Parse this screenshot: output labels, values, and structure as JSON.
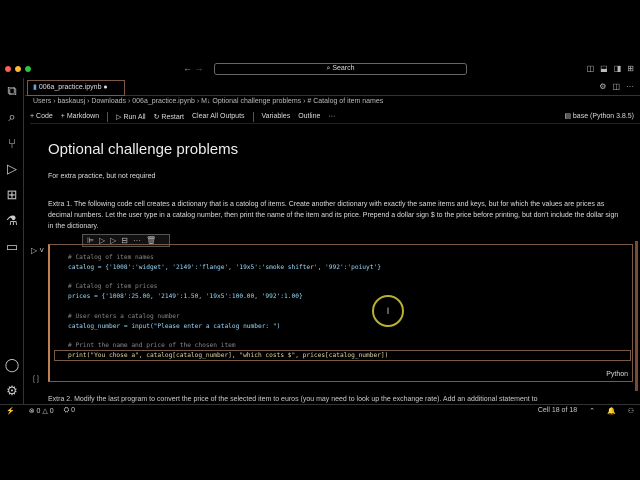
{
  "window": {
    "search": "Search",
    "nav_back": "←",
    "nav_forward": "→"
  },
  "tab": {
    "label": "006a_practice.ipynb",
    "dirty": "●"
  },
  "breadcrumb": [
    "Users",
    "baskausj",
    "Downloads",
    "006a_practice.ipynb",
    "M↓ Optional challenge problems",
    "# Catalog of item names"
  ],
  "toolbar": {
    "code": "+ Code",
    "markdown": "+ Markdown",
    "run_all": "▷ Run All",
    "restart": "↻ Restart",
    "clear": "Clear All Outputs",
    "variables": "Variables",
    "outline": "Outline",
    "more": "···",
    "kernel": "base (Python 3.8.5)"
  },
  "notebook": {
    "title": "Optional challenge problems",
    "subtitle": "For extra practice, but not required",
    "extra1": "Extra 1. The following code cell creates a dictionary that is a catolog of items. Create another dictionary with exactly the same items and keys, but for which the values are prices as decimal numbers. Let the user type in a catalog number, then print the name of the item and its price. Prepend a dollar sign $ to the price before printing, but don't include the dollar sign in the dictionary.",
    "code": {
      "c1": "# Catalog of item names",
      "l1": "catalog = {'1008':'widget', '2149':'flange', '19x5':'smoke shifter', '992':'poiuyt'}",
      "c2": "# Catalog of item prices",
      "l2": "prices = {'1008':25.00, '2149':1.50, '19x5':100.00, '992':1.00}",
      "c3": "# User enters a catalog number",
      "l3": "catalog_number = input(\"Please enter a catalog number: \")",
      "c4": "# Print the name and price of the chosen item",
      "l4": "print(\"You chose a\", catalog[catalog_number], \"which costs $\", prices[catalog_number])"
    },
    "language": "Python",
    "exec_count": "[ ]",
    "extra2": "Extra 2. Modify the last program to convert the price of the selected item to euros (you may need to look up the exchange rate). Add an additional statement to"
  },
  "status": {
    "errors": "0",
    "warnings": "0",
    "ports": "0",
    "cell": "Cell 18 of 18"
  }
}
